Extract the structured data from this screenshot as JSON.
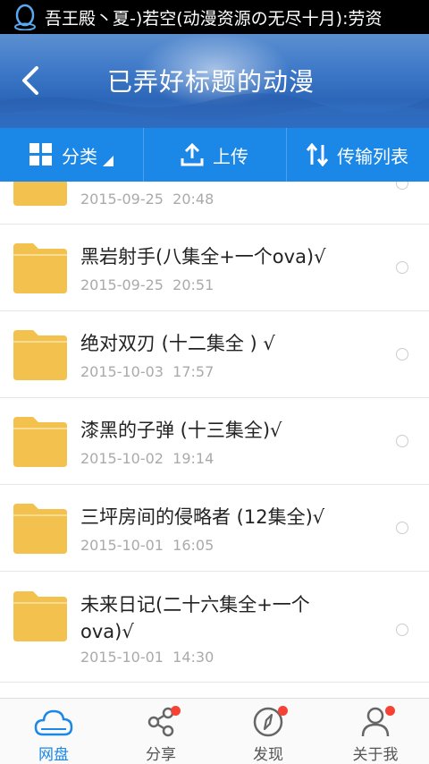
{
  "status_bar": {
    "notification": "吾王殿丶夏-)若空(动漫资源の无尽十月):劳资"
  },
  "header": {
    "title": "已弄好标题的动漫"
  },
  "toolbar": {
    "category_label": "分类",
    "upload_label": "上传",
    "transfer_label": "传输列表"
  },
  "files": [
    {
      "name": "",
      "date": "2015-09-25  20:48"
    },
    {
      "name": "黑岩射手(八集全+一个ova)√",
      "date": "2015-09-25  20:51"
    },
    {
      "name": "绝对双刃 (十二集全 ) √",
      "date": "2015-10-03  17:57"
    },
    {
      "name": "漆黑的子弹 (十三集全)√",
      "date": "2015-10-02  19:14"
    },
    {
      "name": "三坪房间的侵略者 (12集全)√",
      "date": "2015-10-01  16:05"
    },
    {
      "name": "未来日记(二十六集全+一个ova)√",
      "date": "2015-10-01  14:30"
    }
  ],
  "bottom_nav": {
    "items": [
      {
        "label": "网盘",
        "icon": "cloud-icon",
        "active": true
      },
      {
        "label": "分享",
        "icon": "share-icon",
        "badge": true
      },
      {
        "label": "发现",
        "icon": "compass-icon",
        "badge": true
      },
      {
        "label": "关于我",
        "icon": "person-icon",
        "badge": true
      }
    ]
  },
  "colors": {
    "accent": "#1b87e6",
    "folder": "#f2c14e",
    "badge": "#f44336"
  }
}
